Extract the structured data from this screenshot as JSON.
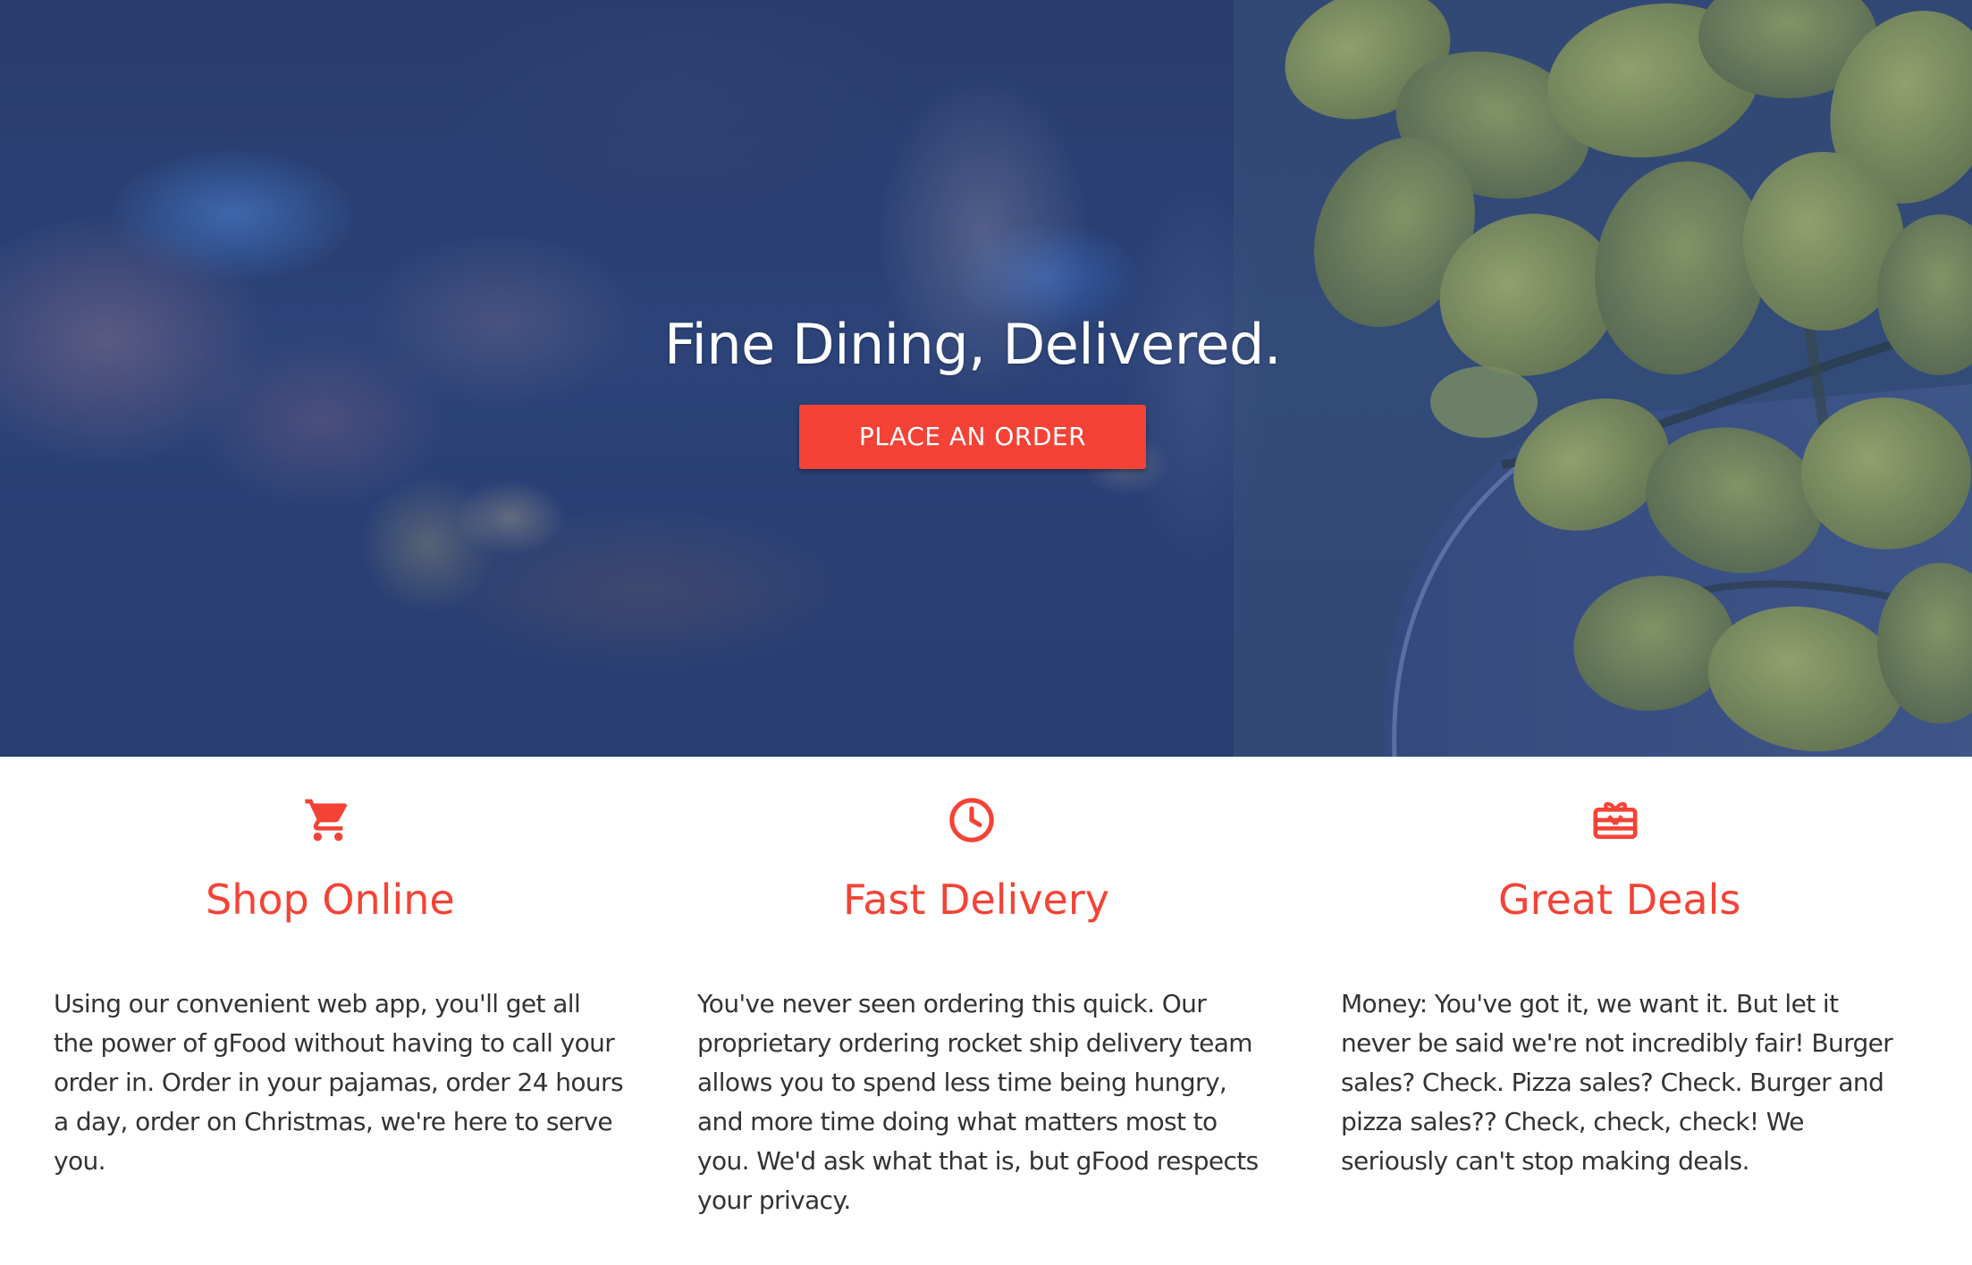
{
  "hero": {
    "title": "Fine Dining, Delivered.",
    "cta_label": "PLACE AN ORDER"
  },
  "features": [
    {
      "icon": "cart-icon",
      "title": "Shop Online",
      "text": "Using our convenient web app, you'll get all the power of gFood without having to call your order in. Order in your pajamas, order 24 hours a day, order on Christmas, we're here to serve you."
    },
    {
      "icon": "clock-icon",
      "title": "Fast Delivery",
      "text": "You've never seen ordering this quick. Our proprietary ordering rocket ship delivery team allows you to spend less time being hungry, and more time doing what matters most to you. We'd ask what that is, but gFood respects your privacy."
    },
    {
      "icon": "gift-card-icon",
      "title": "Great Deals",
      "text": "Money: You've got it, we want it. But let it never be said we're not incredibly fair! Burger sales? Check. Pizza sales? Check. Burger and pizza sales?? Check, check, check! We seriously can't stop making deals."
    }
  ],
  "colors": {
    "accent": "#f44336",
    "hero_tint": "#2f4679",
    "body_text": "#333333"
  }
}
